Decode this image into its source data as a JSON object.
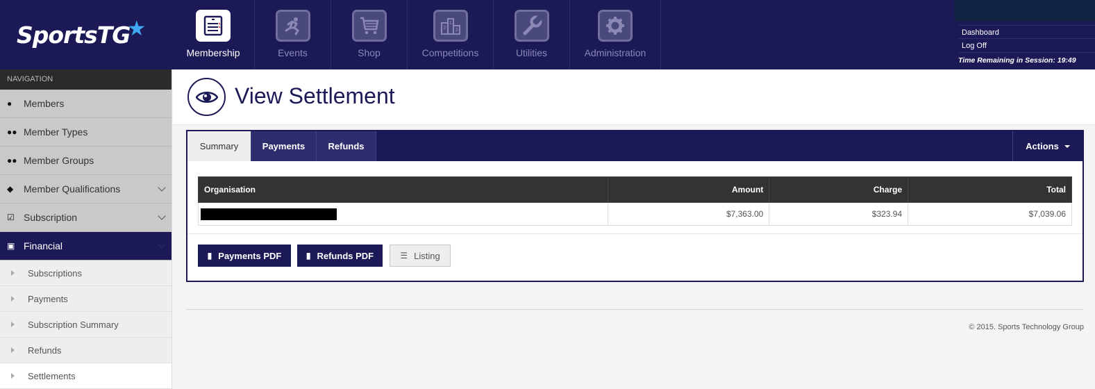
{
  "brand": {
    "name": "SportsTG",
    "star": "★"
  },
  "topnav": [
    {
      "label": "Membership",
      "icon": "membership-card-icon",
      "active": true
    },
    {
      "label": "Events",
      "icon": "runner-icon",
      "active": false
    },
    {
      "label": "Shop",
      "icon": "shopping-cart-icon",
      "active": false
    },
    {
      "label": "Competitions",
      "icon": "podium-icon",
      "active": false
    },
    {
      "label": "Utilities",
      "icon": "wrench-icon",
      "active": false
    },
    {
      "label": "Administration",
      "icon": "gear-icon",
      "active": false
    }
  ],
  "session": {
    "dashboard": "Dashboard",
    "logoff": "Log Off",
    "time_remaining": "Time Remaining in Session: 19:49"
  },
  "sidebar": {
    "heading": "NAVIGATION",
    "items": [
      {
        "label": "Members",
        "icon": "user-icon"
      },
      {
        "label": "Member Types",
        "icon": "users-icon"
      },
      {
        "label": "Member Groups",
        "icon": "users-icon"
      },
      {
        "label": "Member Qualifications",
        "icon": "tags-icon"
      },
      {
        "label": "Subscription",
        "icon": "checkbox-icon"
      },
      {
        "label": "Financial",
        "icon": "money-icon"
      }
    ],
    "subitems": [
      {
        "label": "Subscriptions"
      },
      {
        "label": "Payments"
      },
      {
        "label": "Subscription Summary"
      },
      {
        "label": "Refunds"
      },
      {
        "label": "Settlements"
      }
    ]
  },
  "page": {
    "title": "View Settlement"
  },
  "tabs": [
    {
      "label": "Summary"
    },
    {
      "label": "Payments"
    },
    {
      "label": "Refunds"
    }
  ],
  "actions_label": "Actions",
  "table": {
    "headers": {
      "organisation": "Organisation",
      "amount": "Amount",
      "charge": "Charge",
      "total": "Total"
    },
    "row": {
      "amount": "$7,363.00",
      "charge": "$323.94",
      "total": "$7,039.06"
    }
  },
  "buttons": {
    "payments_pdf": "Payments PDF",
    "refunds_pdf": "Refunds PDF",
    "listing": "Listing"
  },
  "footer": {
    "copyright": "© 2015. Sports Technology Group"
  },
  "colors": {
    "brand": "#1b1a57",
    "accent": "#3fa9f5",
    "table_header": "#333333"
  }
}
